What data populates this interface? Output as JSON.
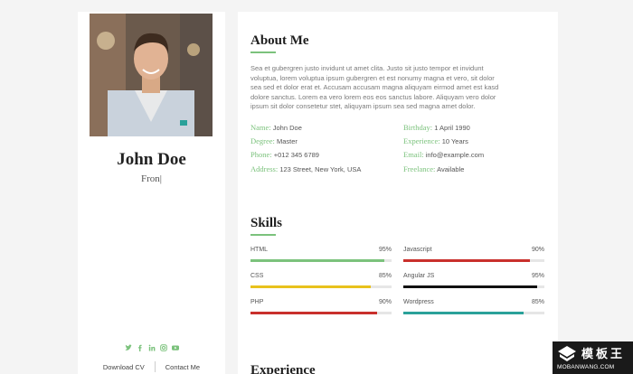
{
  "profile": {
    "name": "John Doe",
    "role": "Fron",
    "caret": "|",
    "links": {
      "download": "Download CV",
      "contact": "Contact Me"
    },
    "social_icons": [
      "twitter-icon",
      "facebook-icon",
      "linkedin-icon",
      "instagram-icon",
      "youtube-icon"
    ]
  },
  "about": {
    "title": "About Me",
    "bio_lines": [
      "Sea et gubergren justo invidunt ut amet clita. Justo sit justo tempor et invidunt",
      "voluptua, lorem voluptua ipsum gubergren et est nonumy magna et vero, sit dolor",
      "sea sed et dolor erat et. Accusam accusam magna aliquyam eirmod amet est kasd",
      "dolore sanctus. Lorem ea vero lorem eos eos sanctus labore. Aliquyam vero dolor",
      "ipsum sit dolor consetetur stet, aliquyam ipsum sea sed magna amet dolor."
    ],
    "info_left": [
      {
        "label": "Name:",
        "value": "John Doe"
      },
      {
        "label": "Degree:",
        "value": "Master"
      },
      {
        "label": "Phone:",
        "value": "+012 345 6789"
      },
      {
        "label": "Address:",
        "value": "123 Street, New York, USA"
      }
    ],
    "info_right": [
      {
        "label": "Birthday:",
        "value": "1 April 1990"
      },
      {
        "label": "Experience:",
        "value": "10 Years"
      },
      {
        "label": "Email:",
        "value": "info@example.com"
      },
      {
        "label": "Freelance:",
        "value": "Available"
      }
    ]
  },
  "skills": {
    "title": "Skills",
    "items": [
      {
        "name": "HTML",
        "percent_label": "95%",
        "level": 95,
        "color": "#7bc27c"
      },
      {
        "name": "Javascript",
        "percent_label": "90%",
        "level": 90,
        "color": "#c9302c"
      },
      {
        "name": "CSS",
        "percent_label": "85%",
        "level": 85,
        "color": "#e8c21c"
      },
      {
        "name": "Angular JS",
        "percent_label": "95%",
        "level": 95,
        "color": "#111111"
      },
      {
        "name": "PHP",
        "percent_label": "90%",
        "level": 90,
        "color": "#c9302c"
      },
      {
        "name": "Wordpress",
        "percent_label": "85%",
        "level": 85,
        "color": "#2aa19a"
      }
    ]
  },
  "experience": {
    "title": "Experience"
  },
  "watermark": {
    "cn": "模板王",
    "en": "MOBANWANG.COM"
  },
  "colors": {
    "accent": "#7bc27c",
    "page_bg": "#f4f4f4",
    "card_bg": "#ffffff"
  }
}
